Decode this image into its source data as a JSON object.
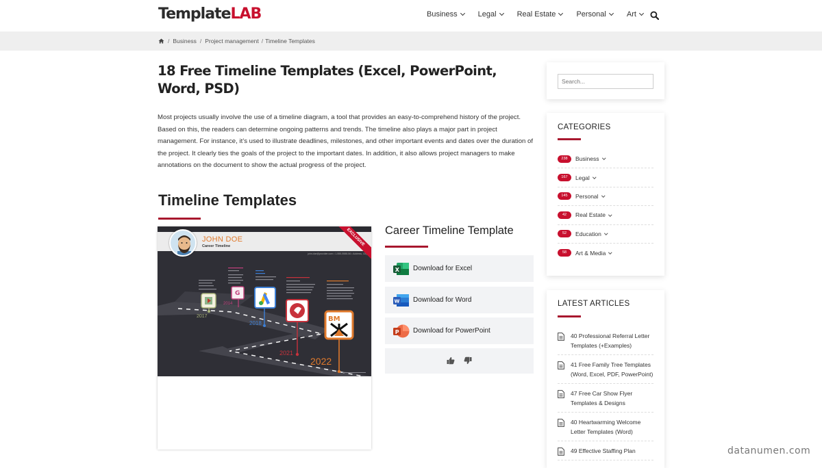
{
  "header": {
    "logo_main": "Template",
    "logo_accent": "LAB",
    "nav": [
      "Business",
      "Legal",
      "Real Estate",
      "Personal",
      "Art"
    ],
    "search_icon": "search-icon"
  },
  "breadcrumb": {
    "home_icon": "home-icon",
    "items": [
      "Business",
      "Project management",
      "Timeline Templates"
    ]
  },
  "article": {
    "title": "18 Free Timeline Templates (Excel, PowerPoint, Word, PSD)",
    "intro": "Most projects usually involve the use of a timeline diagram, a tool that provides an easy-to-comprehend history of the project. Based on this, the readers can determine ongoing patterns and trends. The timeline also plays a major part in project management. For instance, it’s used to illustrate deadlines, milestones, and other important events and dates over the duration of the project. It clearly ties the goals of the project to the important dates. In addition, it also allows project managers to make annotations on the document to show the actual progress of the project.",
    "section_title": "Timeline Templates"
  },
  "template": {
    "preview": {
      "name": "JOHN DOE",
      "subtitle": "Career Timeline",
      "ribbon": "EXCLUSIVE",
      "contact": "john.doe@provider.com  •  1-555-5588-56  •  Address, City",
      "years": [
        "2017",
        "2014",
        "2018",
        "2021",
        "2022"
      ]
    },
    "title": "Career Timeline Template",
    "downloads": [
      {
        "label": "Download for Excel",
        "icon": "excel-icon",
        "color": "#1f7244"
      },
      {
        "label": "Download for Word",
        "icon": "word-icon",
        "color": "#2b5cb8"
      },
      {
        "label": "Download for PowerPoint",
        "icon": "powerpoint-icon",
        "color": "#d04423"
      }
    ],
    "vote_up_icon": "thumbs-up-icon",
    "vote_down_icon": "thumbs-down-icon"
  },
  "sidebar": {
    "search_placeholder": "Search...",
    "categories_title": "CATEGORIES",
    "categories": [
      {
        "count": "238",
        "label": "Business"
      },
      {
        "count": "167",
        "label": "Legal"
      },
      {
        "count": "145",
        "label": "Personal"
      },
      {
        "count": "42",
        "label": "Real Estate"
      },
      {
        "count": "52",
        "label": "Education"
      },
      {
        "count": "58",
        "label": "Art & Media"
      }
    ],
    "latest_title": "LATEST ARTICLES",
    "latest": [
      "40 Professional Referral Letter Templates (+Examples)",
      "41 Free Family Tree Templates (Word, Excel, PDF, PowerPoint)",
      "47 Free Car Show Flyer Templates & Designs",
      "40 Heartwarming Welcome Letter Templates (Word)",
      "49 Effective Staffing Plan"
    ]
  },
  "colors": {
    "accent": "#c8102e",
    "rule": "#a8172e",
    "button_bg": "#f2f3f5"
  },
  "watermark": "datanumen.com"
}
